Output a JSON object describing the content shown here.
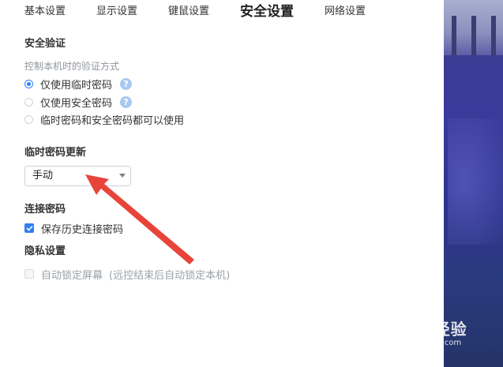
{
  "tabs": [
    {
      "label": "基本设置",
      "active": false
    },
    {
      "label": "显示设置",
      "active": false
    },
    {
      "label": "键鼠设置",
      "active": false
    },
    {
      "label": "安全设置",
      "active": true
    },
    {
      "label": "网络设置",
      "active": false
    }
  ],
  "security_verify": {
    "title": "安全验证",
    "hint": "控制本机时的验证方式",
    "options": [
      {
        "label": "仅使用临时密码",
        "selected": true,
        "help": "?"
      },
      {
        "label": "仅使用安全密码",
        "selected": false,
        "help": "?"
      },
      {
        "label": "临时密码和安全密码都可以使用",
        "selected": false
      }
    ]
  },
  "temp_password_update": {
    "title": "临时密码更新",
    "selected_value": "手动"
  },
  "connection_password": {
    "title": "连接密码",
    "save_history": {
      "label": "保存历史连接密码",
      "checked": true
    }
  },
  "privacy": {
    "title": "隐私设置",
    "auto_lock": {
      "label": "自动锁定屏幕",
      "note": "(远控结束后自动锁定本机)",
      "checked": false,
      "disabled": true
    }
  },
  "watermark": {
    "main": "Bai度经验",
    "sub": "jingyan.baidu.com"
  },
  "colors": {
    "accent": "#2f7ff0",
    "annotation_arrow": "#e8443a"
  }
}
